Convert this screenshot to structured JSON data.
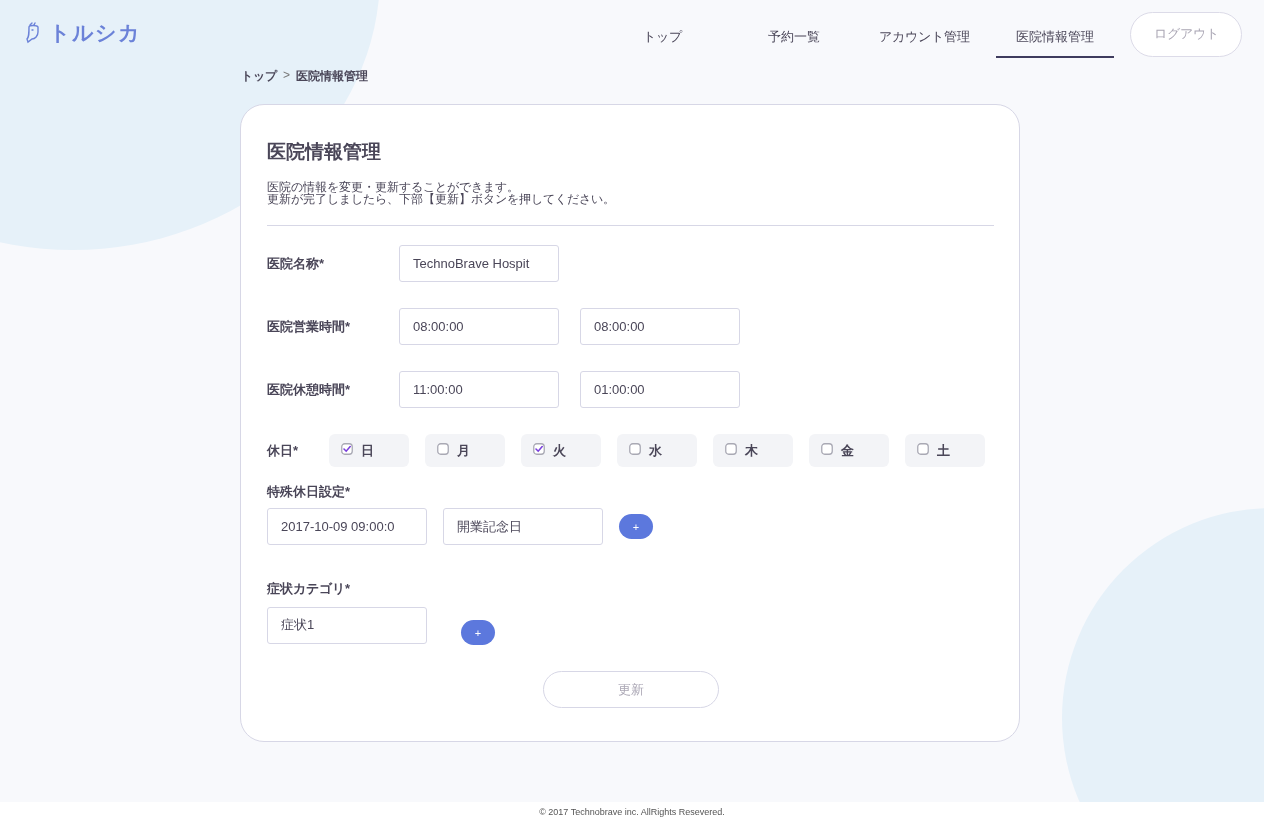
{
  "logo": {
    "text": "トルシカ"
  },
  "nav": {
    "items": [
      {
        "label": "トップ",
        "selected": false
      },
      {
        "label": "予約一覧",
        "selected": false
      },
      {
        "label": "アカウント管理",
        "selected": false
      },
      {
        "label": "医院情報管理",
        "selected": true
      }
    ],
    "logout": "ログアウト"
  },
  "breadcrumb": {
    "items": [
      "トップ",
      "医院情報管理"
    ],
    "separator": ">"
  },
  "card": {
    "title": "医院情報管理",
    "description": [
      "医院の情報を変更・更新することができます。",
      "更新が完了しましたら、下部【更新】ボタンを押してください。"
    ]
  },
  "form": {
    "clinic_name": {
      "label": "医院名称*",
      "value": "TechnoBrave Hospit"
    },
    "business_hours": {
      "label": "医院営業時間*",
      "values": [
        "08:00:00",
        "08:00:00"
      ]
    },
    "break_hours": {
      "label": "医院休憩時間*",
      "values": [
        "11:00:00",
        "01:00:00"
      ]
    },
    "holidays": {
      "label": "休日*",
      "days": [
        {
          "label": "日",
          "checked": true
        },
        {
          "label": "月",
          "checked": false
        },
        {
          "label": "火",
          "checked": true
        },
        {
          "label": "水",
          "checked": false
        },
        {
          "label": "木",
          "checked": false
        },
        {
          "label": "金",
          "checked": false
        },
        {
          "label": "土",
          "checked": false
        }
      ]
    },
    "special_holidays": {
      "label": "特殊休日設定*",
      "date": "2017-10-09 09:00:0",
      "name": "開業記念日",
      "add": "+"
    },
    "symptoms": {
      "label": "症状カテゴリ*",
      "values": [
        "症状1"
      ],
      "add": "+"
    },
    "submit": "更新"
  },
  "footer": "© 2017 Technobrave inc. AllRights Resevered."
}
